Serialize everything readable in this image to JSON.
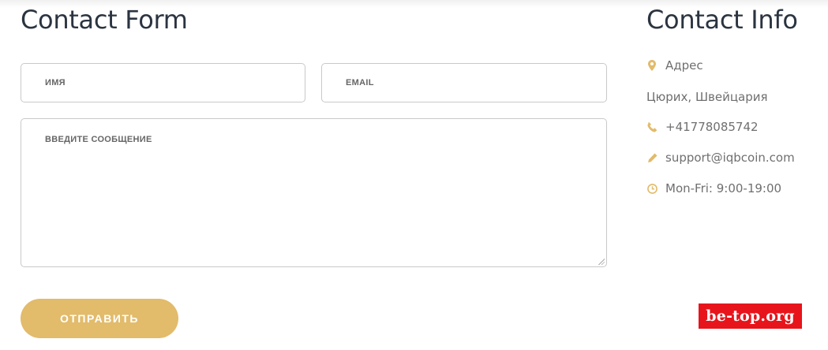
{
  "form": {
    "title": "Contact Form",
    "name_placeholder": "ИМЯ",
    "email_placeholder": "EMAIL",
    "message_placeholder": "ВВЕДИТЕ СООБЩЕНИЕ",
    "submit_label": "ОТПРАВИТЬ"
  },
  "info": {
    "title": "Contact Info",
    "address_label": "Адрес",
    "address_value": "Цюрих, Швейцария",
    "phone": "+41778085742",
    "email": "support@iqbcoin.com",
    "hours": "Mon-Fri: 9:00-19:00"
  },
  "icons": {
    "address": "map-marker-icon",
    "phone": "phone-icon",
    "email": "pencil-icon",
    "hours": "clock-icon"
  },
  "colors": {
    "accent": "#e2bb6b",
    "heading": "#2b3440",
    "text": "#6f6f6f",
    "watermark_bg": "#e8141b"
  },
  "watermark": "be-top.org"
}
